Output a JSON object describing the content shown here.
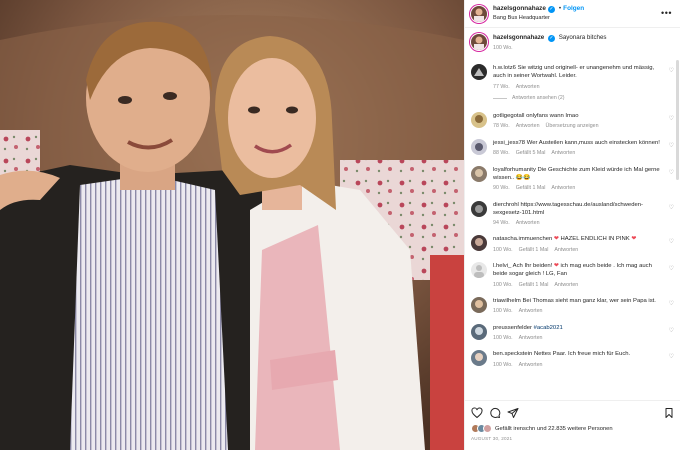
{
  "post": {
    "username": "hazelsgonnahaze",
    "follow_label": "Folgen",
    "location": "Bang Bus Headquarter",
    "caption": "Sayonara bitches",
    "caption_time": "100 Wo."
  },
  "comments": [
    {
      "user": "h.w.lotz6",
      "text": "Sie witzig und originell- er unangenehm und mässig, auch in seiner Wortwahl. Leider.",
      "time": "77 Wo.",
      "reply": "Antworten",
      "view_replies": "Antworten ansehen (2)"
    },
    {
      "user": "gotligegotall",
      "text": "onlyfans wann Imao",
      "time": "78 Wo.",
      "reply": "Antworten",
      "extra": "Übersetzung anzeigen"
    },
    {
      "user": "jessi_jess78",
      "text": "Wer Austeilen kann,muss auch einstecken können!",
      "time": "88 Wo.",
      "likes": "Gefällt 5 Mal",
      "reply": "Antworten"
    },
    {
      "user": "loyalforhumanity",
      "text": "Die Geschichte zum Kleid würde ich Mal gerne wissen..",
      "emoji": "😂😂",
      "time": "90 Wo.",
      "likes": "Gefällt 1 Mal",
      "reply": "Antworten"
    },
    {
      "user": "dierchrohl",
      "text": "https://www.tagesschau.de/ausland/schweden-sexgesetz-101.html",
      "time": "94 Wo.",
      "reply": "Antworten"
    },
    {
      "user": "natascha.immuenchen",
      "text": "HAZEL ENDLICH IN PINK",
      "time": "100 Wo.",
      "likes": "Gefällt 1 Mal",
      "reply": "Antworten"
    },
    {
      "user": "l.helvi_",
      "text": "Ach Ihr beiden!",
      "text2": "ich mag euch beide . Ich mag auch beide sogar gleich ! LG, Fan",
      "time": "100 Wo.",
      "likes": "Gefällt 1 Mal",
      "reply": "Antworten"
    },
    {
      "user": "triawilhelm",
      "text": "Bei Thomas sieht man ganz klar, wer sein Papa ist.",
      "time": "100 Wo.",
      "reply": "Antworten"
    },
    {
      "user": "preussenfelder",
      "tag": "#acab2021",
      "time": "100 Wo.",
      "reply": "Antworten"
    },
    {
      "user": "ben.speckstein",
      "text": "Nettes Paar. Ich freue mich für Euch.",
      "time": "100 Wo.",
      "reply": "Antworten"
    }
  ],
  "likes": {
    "text": "Gefällt irenschn und 22.835 weitere Personen"
  },
  "date": "AUGUST 30, 2021",
  "colors": {
    "link_blue": "#0095f6",
    "verified_blue": "#0095f6",
    "heart_red": "#ed4956",
    "meta_gray": "#8e8e8e"
  },
  "icons": [
    "heart-icon",
    "comment-icon",
    "share-icon",
    "bookmark-icon",
    "more-icon",
    "verified-icon"
  ]
}
